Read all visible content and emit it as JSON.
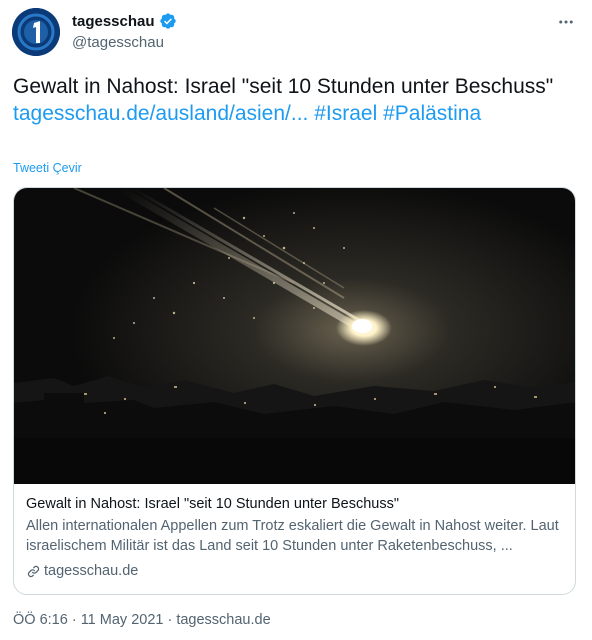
{
  "tweet": {
    "display_name": "tagesschau",
    "handle": "@tagesschau",
    "text_plain": "Gewalt in Nahost: Israel \"seit 10 Stunden unter Beschuss\"",
    "url_link": "tagesschau.de/ausland/asien/...",
    "hashtag_1": "#Israel",
    "hashtag_2": "#Palästina",
    "translate_label": "Tweeti Çevir",
    "timestamp": "ÖÖ 6:16 · 11 May 2021 · tagesschau.de"
  },
  "card": {
    "title": "Gewalt in Nahost: Israel \"seit 10 Stunden unter Beschuss\"",
    "description": "Allen internationalen Appellen zum Trotz eskaliert die Gewalt in Nahost weiter. Laut israelischem Militär ist das Land seit 10 Stunden unter Raketenbeschuss, ...",
    "domain": "tagesschau.de"
  },
  "colors": {
    "link": "#1d9bf0",
    "secondary_text": "#536471",
    "brand": "#0a3b78",
    "verified": "#1d9bf0"
  },
  "icons": [
    "tagesschau-logo-icon",
    "verified-badge-icon",
    "more-options-icon",
    "link-icon"
  ]
}
